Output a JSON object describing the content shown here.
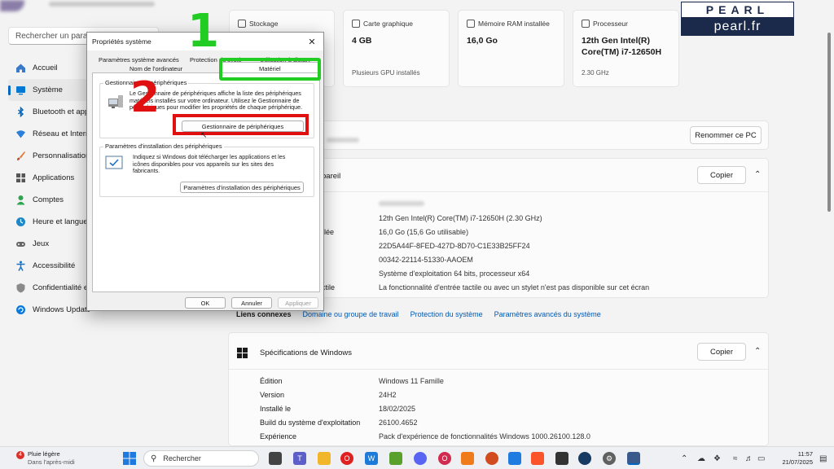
{
  "settings": {
    "search_placeholder": "Rechercher un paramètre",
    "nav": [
      {
        "label": "Accueil",
        "icon": "home-icon",
        "color": "#3a78c9"
      },
      {
        "label": "Système",
        "icon": "system-icon",
        "color": "#0078d4"
      },
      {
        "label": "Bluetooth et appareils",
        "icon": "bluetooth-icon",
        "color": "#0067c0"
      },
      {
        "label": "Réseau et Internet",
        "icon": "network-icon",
        "color": "#2b7fd9"
      },
      {
        "label": "Personnalisation",
        "icon": "brush-icon",
        "color": "#e07a2d"
      },
      {
        "label": "Applications",
        "icon": "apps-icon",
        "color": "#555555"
      },
      {
        "label": "Comptes",
        "icon": "accounts-icon",
        "color": "#2ea44f"
      },
      {
        "label": "Heure et langue",
        "icon": "time-language-icon",
        "color": "#1e88c7"
      },
      {
        "label": "Jeux",
        "icon": "gaming-icon",
        "color": "#666666"
      },
      {
        "label": "Accessibilité",
        "icon": "accessibility-icon",
        "color": "#1a73c9"
      },
      {
        "label": "Confidentialité et sécurité",
        "icon": "shield-icon",
        "color": "#777777"
      },
      {
        "label": "Windows Update",
        "icon": "update-icon",
        "color": "#0a78d8"
      }
    ],
    "cards": [
      {
        "title": "Stockage",
        "value": "",
        "sub": ""
      },
      {
        "title": "Carte graphique",
        "value": "4 GB",
        "sub": "Plusieurs GPU installés"
      },
      {
        "title": "Mémoire RAM installée",
        "value": "16,0 Go",
        "sub": ""
      },
      {
        "title": "Processeur",
        "value": "12th Gen Intel(R) Core(TM) i7-12650H",
        "sub": "2.30 GHz"
      }
    ],
    "rename_button": "Renommer ce PC",
    "device_specs": {
      "title_partial": "pareil",
      "copy_button": "Copier",
      "rows": [
        {
          "label": "",
          "value": ""
        },
        {
          "label": "",
          "value": "12th Gen Intel(R) Core(TM) i7-12650H (2.30 GHz)"
        },
        {
          "label": "allée",
          "value": "16,0 Go (15,6 Go utilisable)"
        },
        {
          "label": "",
          "value": "22D5A44F-8FED-427D-8D70-C1E33B25FF24"
        },
        {
          "label": "",
          "value": "00342-22114-51330-AAOEM"
        },
        {
          "label": "",
          "value": "Système d'exploitation 64 bits, processeur x64"
        },
        {
          "label": "ctile",
          "value": "La fonctionnalité d'entrée tactile ou avec un stylet n'est pas disponible sur cet écran"
        }
      ]
    },
    "related_links": {
      "label": "Liens connexes",
      "links": [
        "Domaine ou groupe de travail",
        "Protection du système",
        "Paramètres avancés du système"
      ]
    },
    "windows_specs": {
      "title": "Spécifications de Windows",
      "copy_button": "Copier",
      "rows": [
        {
          "label": "Édition",
          "value": "Windows 11 Famille"
        },
        {
          "label": "Version",
          "value": "24H2"
        },
        {
          "label": "Installé le",
          "value": "18/02/2025"
        },
        {
          "label": "Build du système d'exploitation",
          "value": "26100.4652"
        },
        {
          "label": "Expérience",
          "value": "Pack d'expérience de fonctionnalités Windows 1000.26100.128.0"
        }
      ]
    }
  },
  "logo": {
    "top": "PEARL",
    "bottom": "pearl.fr"
  },
  "dialog": {
    "title": "Propriétés système",
    "tabs": {
      "advanced": "Paramètres système avancés",
      "protection": "Protection du système",
      "remote": "Utilisation à distance",
      "computer_name": "Nom de l'ordinateur",
      "hardware": "Matériel"
    },
    "device_manager_group": {
      "title": "Gestionnaire de périphériques",
      "text": "Le Gestionnaire de périphériques affiche la liste des périphériques matériels installés sur votre ordinateur. Utilisez le Gestionnaire de périphériques pour modifier les propriétés de chaque périphérique.",
      "button": "Gestionnaire de périphériques"
    },
    "install_group": {
      "title": "Paramètres d'installation des périphériques",
      "text": "Indiquez si Windows doit télécharger les applications et les icônes disponibles pour vos appareils sur les sites des fabricants.",
      "button": "Paramètres d'installation des périphériques"
    },
    "ok": "OK",
    "cancel": "Annuler",
    "apply": "Appliquer"
  },
  "annotations": {
    "step1": "1",
    "step2": "2",
    "step1_color": "#22cc22",
    "step2_color": "#e01010"
  },
  "taskbar": {
    "weather_temp_badge": "4",
    "weather_title": "Pluie légère",
    "weather_sub": "Dans l'après-midi",
    "search_label": "Rechercher",
    "time": "11:57",
    "date": "21/07/2025"
  }
}
